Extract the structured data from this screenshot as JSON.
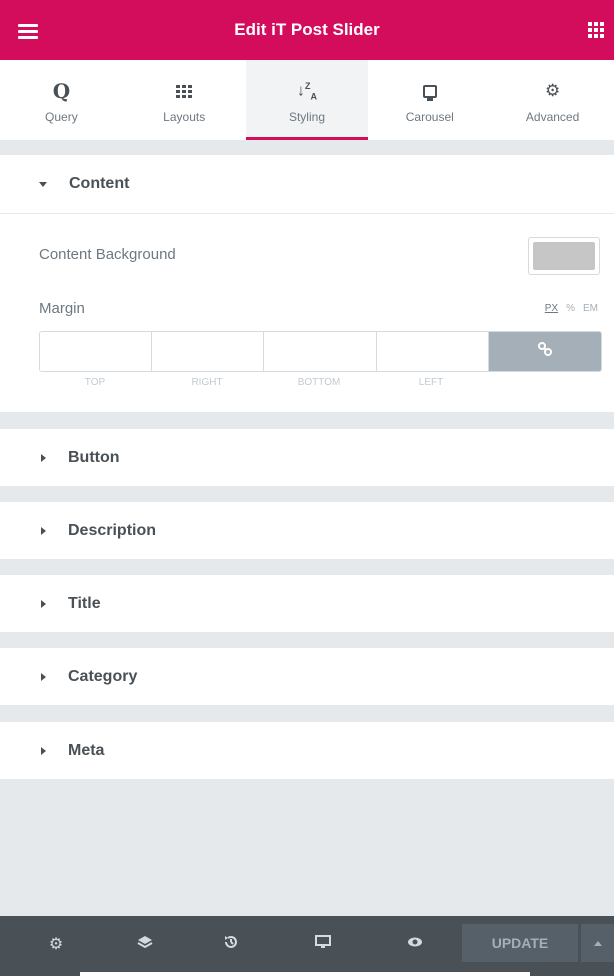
{
  "header": {
    "title": "Edit iT Post Slider"
  },
  "tabs": [
    {
      "label": "Query",
      "icon": "query-icon"
    },
    {
      "label": "Layouts",
      "icon": "layouts-icon"
    },
    {
      "label": "Styling",
      "icon": "sort-az-icon",
      "active": true
    },
    {
      "label": "Carousel",
      "icon": "carousel-icon"
    },
    {
      "label": "Advanced",
      "icon": "gear-icon"
    }
  ],
  "content_section": {
    "title": "Content",
    "background_label": "Content Background",
    "background_color": "#c6c6c6",
    "margin_label": "Margin",
    "units": [
      "PX",
      "%",
      "EM"
    ],
    "active_unit": "PX",
    "margin_fields": [
      "TOP",
      "RIGHT",
      "BOTTOM",
      "LEFT"
    ]
  },
  "sections": [
    "Button",
    "Description",
    "Title",
    "Category",
    "Meta"
  ],
  "footer": {
    "update_label": "UPDATE"
  },
  "colors": {
    "accent": "#d30c5c",
    "panel_bg": "#e6e9ec",
    "footer_bg": "#495157"
  }
}
